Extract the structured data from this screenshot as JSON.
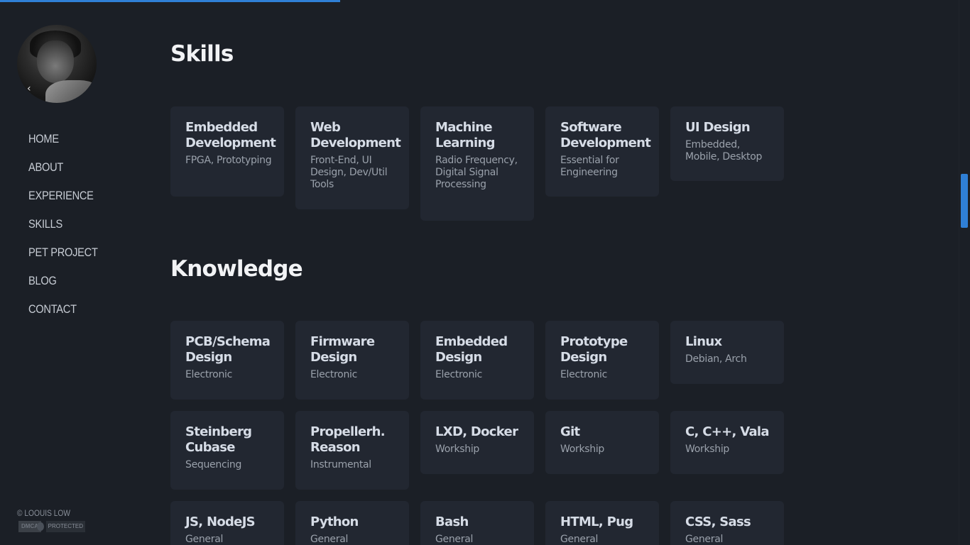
{
  "sidebar": {
    "nav": [
      "HOME",
      "ABOUT",
      "EXPERIENCE",
      "SKILLS",
      "PET PROJECT",
      "BLOG",
      "CONTACT"
    ],
    "copyright": "© LOOUIS LOW",
    "dmca_left": "DMCA",
    "dmca_right": "PROTECTED"
  },
  "skills": {
    "title": "Skills",
    "cards": [
      {
        "title": "Embedded Development",
        "sub": "FPGA, Prototyping"
      },
      {
        "title": "Web Development",
        "sub": "Front-End, UI Design, Dev/Util Tools"
      },
      {
        "title": "Machine Learning",
        "sub": "Radio Frequency, Digital Signal Processing"
      },
      {
        "title": "Software Development",
        "sub": "Essential for Engineering"
      },
      {
        "title": "UI Design",
        "sub": "Embedded, Mobile, Desktop"
      }
    ]
  },
  "knowledge": {
    "title": "Knowledge",
    "cards": [
      {
        "title": "PCB/Schema Design",
        "sub": "Electronic"
      },
      {
        "title": "Firmware Design",
        "sub": "Electronic"
      },
      {
        "title": "Embedded Design",
        "sub": "Electronic"
      },
      {
        "title": "Prototype Design",
        "sub": "Electronic"
      },
      {
        "title": "Linux",
        "sub": "Debian, Arch"
      },
      {
        "title": "Steinberg Cubase",
        "sub": "Sequencing"
      },
      {
        "title": "Propellerh. Reason",
        "sub": "Instrumental"
      },
      {
        "title": "LXD, Docker",
        "sub": "Workship"
      },
      {
        "title": "Git",
        "sub": "Workship"
      },
      {
        "title": "C, C++, Vala",
        "sub": "Workship"
      },
      {
        "title": "JS, NodeJS",
        "sub": "General"
      },
      {
        "title": "Python",
        "sub": "General"
      },
      {
        "title": "Bash",
        "sub": "General"
      },
      {
        "title": "HTML, Pug",
        "sub": "General"
      },
      {
        "title": "CSS, Sass",
        "sub": "General"
      }
    ]
  },
  "colors": {
    "accent": "#2f7fd6",
    "background": "#1b1f26",
    "card": "#222731"
  }
}
